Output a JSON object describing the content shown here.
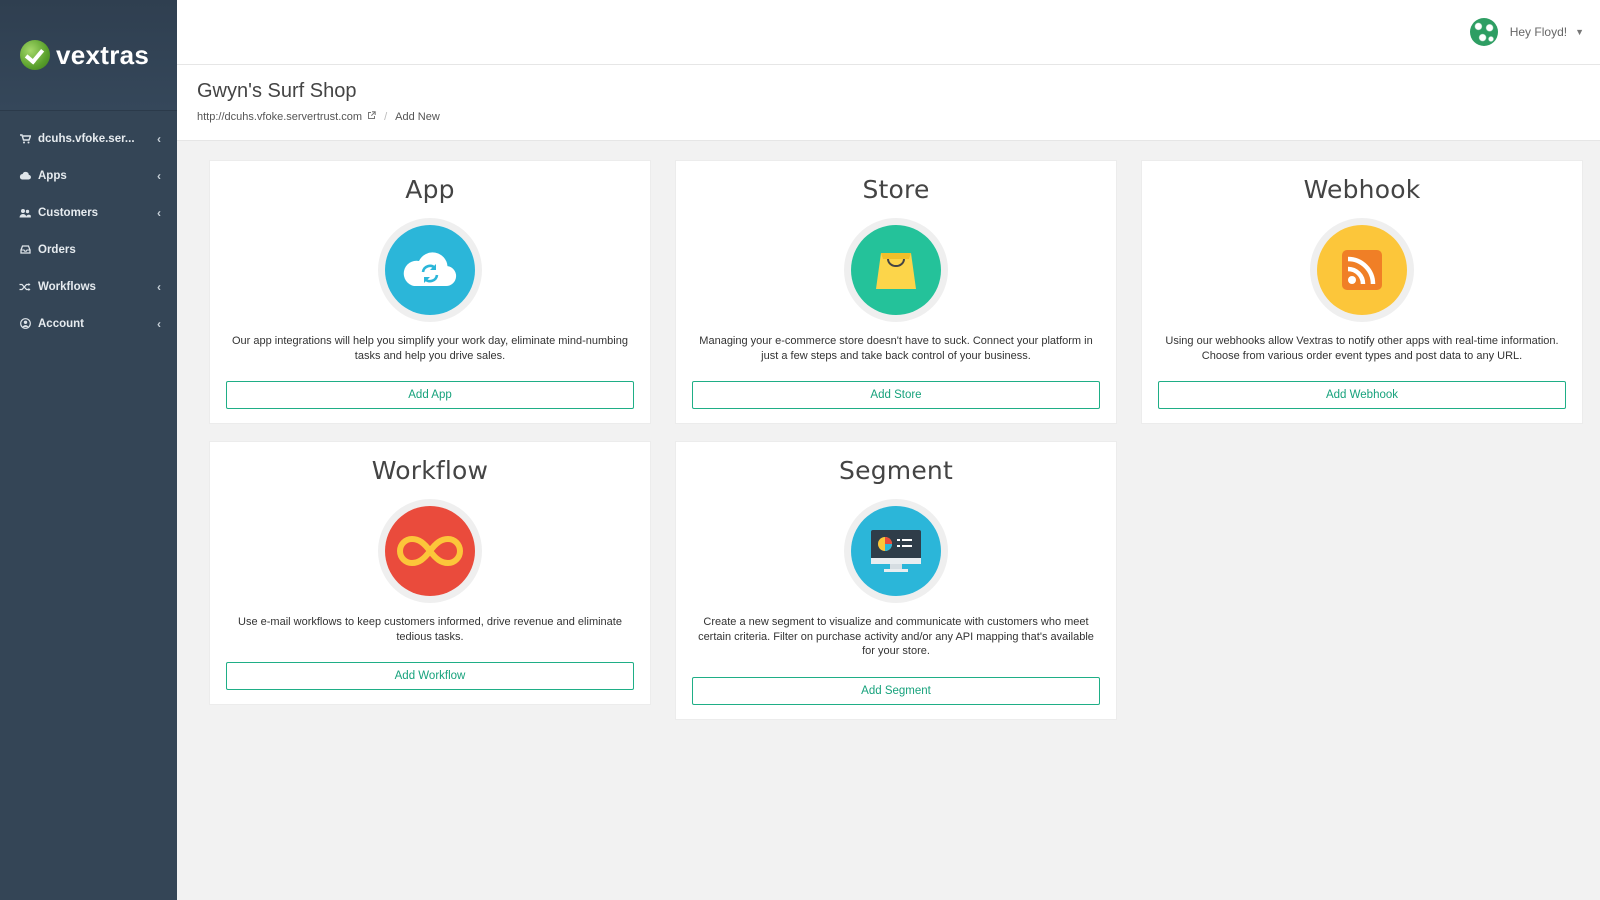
{
  "brand": {
    "name": "vextras"
  },
  "sidebar": {
    "items": [
      {
        "label": "dcuhs.vfoke.ser...",
        "icon": "cart-icon",
        "has_chevron": true
      },
      {
        "label": "Apps",
        "icon": "cloud-icon",
        "has_chevron": true
      },
      {
        "label": "Customers",
        "icon": "users-icon",
        "has_chevron": true
      },
      {
        "label": "Orders",
        "icon": "inbox-icon",
        "has_chevron": false
      },
      {
        "label": "Workflows",
        "icon": "shuffle-icon",
        "has_chevron": true
      },
      {
        "label": "Account",
        "icon": "user-circle-icon",
        "has_chevron": true
      }
    ]
  },
  "topbar": {
    "greeting": "Hey Floyd!"
  },
  "page": {
    "title": "Gwyn's Surf Shop",
    "breadcrumb": {
      "url": "http://dcuhs.vfoke.servertrust.com",
      "current": "Add New"
    }
  },
  "cards": [
    {
      "title": "App",
      "icon": "cloud-sync-icon",
      "color": "#2bb6d9",
      "description": "Our app integrations will help you simplify your work day, eliminate mind-numbing tasks and help you drive sales.",
      "button": "Add App"
    },
    {
      "title": "Store",
      "icon": "shopping-bag-icon",
      "color": "#24c29a",
      "description": "Managing your e-commerce store doesn't have to suck. Connect your platform in just a few steps and take back control of your business.",
      "button": "Add Store"
    },
    {
      "title": "Webhook",
      "icon": "rss-icon",
      "color": "#fcc63a",
      "description": "Using our webhooks allow Vextras to notify other apps with real-time information. Choose from various order event types and post data to any URL.",
      "button": "Add Webhook"
    },
    {
      "title": "Workflow",
      "icon": "infinity-icon",
      "color": "#ea4b3c",
      "description": "Use e-mail workflows to keep customers informed, drive revenue and eliminate tedious tasks.",
      "button": "Add Workflow"
    },
    {
      "title": "Segment",
      "icon": "monitor-chart-icon",
      "color": "#2bb6d9",
      "description": "Create a new segment to visualize and communicate with customers who meet certain criteria. Filter on purchase activity and/or any API mapping that's available for your store.",
      "button": "Add Segment"
    }
  ]
}
